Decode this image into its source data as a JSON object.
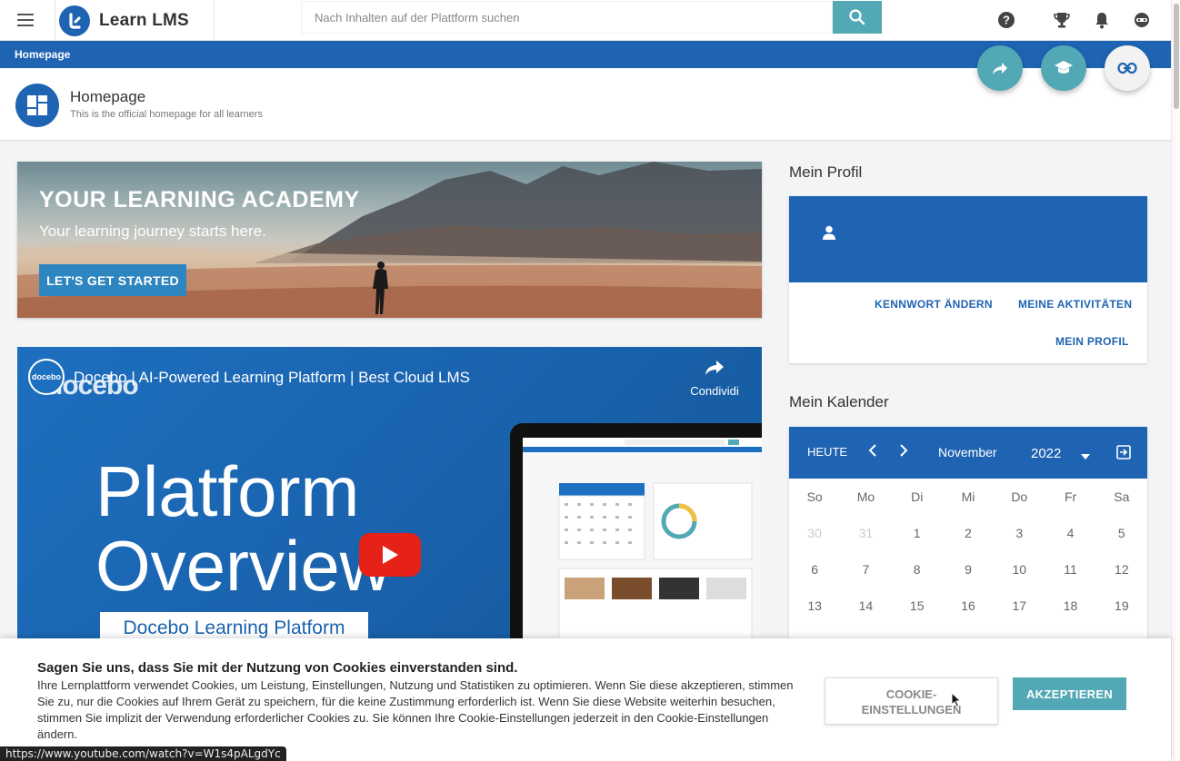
{
  "app": {
    "logo_text": "Learn LMS",
    "search_placeholder": "Nach Inhalten auf der Plattform suchen"
  },
  "topbar_icons": [
    "help-icon",
    "trophy-icon",
    "bell-icon",
    "avatar-icon"
  ],
  "breadcrumb": {
    "current": "Homepage"
  },
  "page": {
    "title": "Homepage",
    "subtitle": "This is the official homepage for all learners"
  },
  "banner": {
    "title": "YOUR LEARNING ACADEMY",
    "subtitle": "Your learning journey starts here.",
    "button": "LET'S GET STARTED"
  },
  "video": {
    "channel_badge": "docebo",
    "brand": "docebo",
    "title": "Docebo | AI-Powered Learning Platform | Best Cloud LMS",
    "share_label": "Condividi",
    "line1": "Platform",
    "line2": "Overview",
    "pill": "Docebo Learning Platform"
  },
  "profile": {
    "section_title": "Mein Profil",
    "links": {
      "password": "KENNWORT ÄNDERN",
      "activities": "MEINE AKTIVITÄTEN",
      "profile": "MEIN PROFIL"
    }
  },
  "calendar": {
    "section_title": "Mein Kalender",
    "today": "HEUTE",
    "month": "November",
    "year": "2022",
    "weekdays": [
      "So",
      "Mo",
      "Di",
      "Mi",
      "Do",
      "Fr",
      "Sa"
    ],
    "weeks": [
      [
        "30",
        "31",
        "1",
        "2",
        "3",
        "4",
        "5"
      ],
      [
        "6",
        "7",
        "8",
        "9",
        "10",
        "11",
        "12"
      ],
      [
        "13",
        "14",
        "15",
        "16",
        "17",
        "18",
        "19"
      ]
    ],
    "muted_days": [
      "30",
      "31"
    ]
  },
  "cookie": {
    "title": "Sagen Sie uns, dass Sie mit der Nutzung von Cookies einverstanden sind.",
    "text": "Ihre Lernplattform verwendet Cookies, um Leistung, Einstellungen, Nutzung und Statistiken zu optimieren. Wenn Sie diese akzeptieren, stimmen Sie zu, nur die Cookies auf Ihrem Gerät zu speichern, für die keine Zustimmung erforderlich ist. Wenn Sie diese Website weiterhin besuchen, stimmen Sie implizit der Verwendung erforderlicher Cookies zu. Sie können Ihre Cookie-Einstellungen jederzeit in den Cookie-Einstellungen ändern.",
    "settings_line1": "COOKIE-",
    "settings_line2": "EINSTELLUNGEN",
    "accept": "AKZEPTIEREN"
  },
  "status_url": "https://www.youtube.com/watch?v=W1s4pALgdYc",
  "colors": {
    "primary": "#1f63b3",
    "accent": "#52a8b5",
    "youtube_red": "#e62117"
  }
}
